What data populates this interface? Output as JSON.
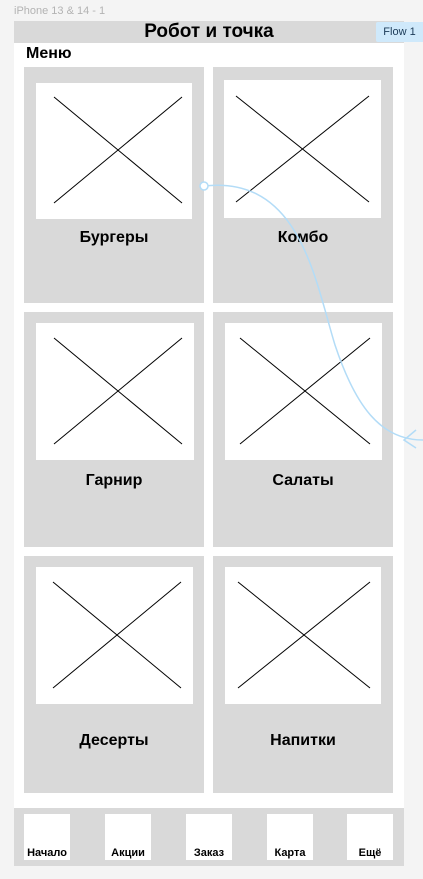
{
  "canvas": {
    "frame_label": "iPhone 13 & 14 - 1",
    "flow_label": "Flow 1"
  },
  "header": {
    "title": "Робот и точка"
  },
  "menu": {
    "title": "Меню",
    "categories": [
      {
        "label": "Бургеры",
        "icon": "image-placeholder-icon"
      },
      {
        "label": "Комбо",
        "icon": "image-placeholder-icon"
      },
      {
        "label": "Гарнир",
        "icon": "image-placeholder-icon"
      },
      {
        "label": "Салаты",
        "icon": "image-placeholder-icon"
      },
      {
        "label": "Десерты",
        "icon": "image-placeholder-icon"
      },
      {
        "label": "Напитки",
        "icon": "image-placeholder-icon"
      }
    ]
  },
  "tabbar": {
    "items": [
      {
        "label": "Начало"
      },
      {
        "label": "Акции"
      },
      {
        "label": "Заказ"
      },
      {
        "label": "Карта"
      },
      {
        "label": "Ещё"
      }
    ]
  },
  "colors": {
    "canvas_bg": "#f4f4f4",
    "frame_bg": "#ffffff",
    "placeholder_gray": "#d9d9d9",
    "flow_accent": "#b3dcf7",
    "flow_badge_bg": "#cfe9fb"
  }
}
